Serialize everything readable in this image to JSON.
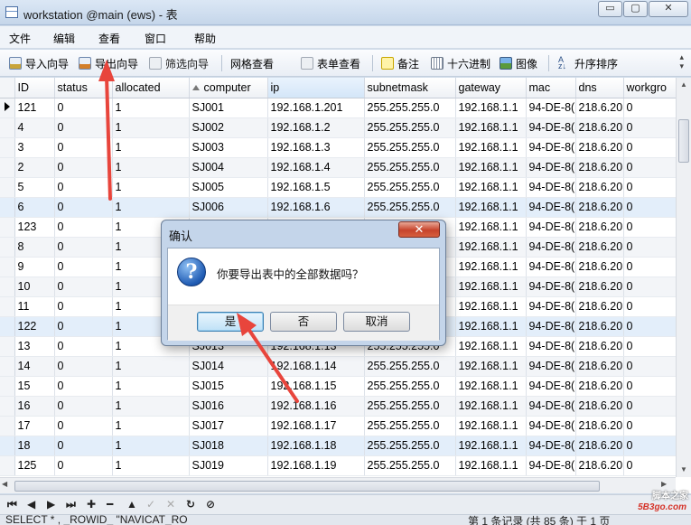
{
  "window": {
    "title": "workstation @main (ews) - 表",
    "buttons": {
      "min": "▭",
      "max": "▢",
      "close": "✕"
    }
  },
  "menu": [
    "文件",
    "编辑",
    "查看",
    "窗口",
    "帮助"
  ],
  "toolbar": {
    "import_wizard": "导入向导",
    "export_wizard": "导出向导",
    "filter_wizard": "筛选向导",
    "grid_view": "网格查看",
    "form_view": "表单查看",
    "memo": "备注",
    "hex": "十六进制",
    "image": "图像",
    "sort_asc": "升序排序",
    "icons": [
      "import-icon",
      "export-icon",
      "filter-icon",
      "grid-icon",
      "form-icon",
      "note-icon",
      "hex-icon",
      "image-icon",
      "sort-icon"
    ]
  },
  "table": {
    "columns": [
      "ID",
      "status",
      "allocated",
      "computer",
      "ip",
      "subnetmask",
      "gateway",
      "mac",
      "dns",
      "workgro"
    ],
    "sorted_column": "computer",
    "rows": [
      [
        "121",
        "0",
        "1",
        "SJ001",
        "192.168.1.201",
        "255.255.255.0",
        "192.168.1.1",
        "94-DE-8(",
        "218.6.20",
        "0"
      ],
      [
        "4",
        "0",
        "1",
        "SJ002",
        "192.168.1.2",
        "255.255.255.0",
        "192.168.1.1",
        "94-DE-8(",
        "218.6.20",
        "0"
      ],
      [
        "3",
        "0",
        "1",
        "SJ003",
        "192.168.1.3",
        "255.255.255.0",
        "192.168.1.1",
        "94-DE-8(",
        "218.6.20",
        "0"
      ],
      [
        "2",
        "0",
        "1",
        "SJ004",
        "192.168.1.4",
        "255.255.255.0",
        "192.168.1.1",
        "94-DE-8(",
        "218.6.20",
        "0"
      ],
      [
        "5",
        "0",
        "1",
        "SJ005",
        "192.168.1.5",
        "255.255.255.0",
        "192.168.1.1",
        "94-DE-8(",
        "218.6.20",
        "0"
      ],
      [
        "6",
        "0",
        "1",
        "SJ006",
        "192.168.1.6",
        "255.255.255.0",
        "192.168.1.1",
        "94-DE-8(",
        "218.6.20",
        "0"
      ],
      [
        "123",
        "0",
        "1",
        "",
        "",
        "",
        "192.168.1.1",
        "94-DE-8(",
        "218.6.20",
        "0"
      ],
      [
        "8",
        "0",
        "1",
        "",
        "",
        "",
        "192.168.1.1",
        "94-DE-8(",
        "218.6.20",
        "0"
      ],
      [
        "9",
        "0",
        "1",
        "",
        "",
        "",
        "192.168.1.1",
        "94-DE-8(",
        "218.6.20",
        "0"
      ],
      [
        "10",
        "0",
        "1",
        "",
        "",
        "",
        "192.168.1.1",
        "94-DE-8(",
        "218.6.20",
        "0"
      ],
      [
        "11",
        "0",
        "1",
        "",
        "",
        "",
        "192.168.1.1",
        "94-DE-8(",
        "218.6.20",
        "0"
      ],
      [
        "122",
        "0",
        "1",
        "",
        "",
        "",
        "192.168.1.1",
        "94-DE-8(",
        "218.6.20",
        "0"
      ],
      [
        "13",
        "0",
        "1",
        "SJ013",
        "192.168.1.13",
        "255.255.255.0",
        "192.168.1.1",
        "94-DE-8(",
        "218.6.20",
        "0"
      ],
      [
        "14",
        "0",
        "1",
        "SJ014",
        "192.168.1.14",
        "255.255.255.0",
        "192.168.1.1",
        "94-DE-8(",
        "218.6.20",
        "0"
      ],
      [
        "15",
        "0",
        "1",
        "SJ015",
        "192.168.1.15",
        "255.255.255.0",
        "192.168.1.1",
        "94-DE-8(",
        "218.6.20",
        "0"
      ],
      [
        "16",
        "0",
        "1",
        "SJ016",
        "192.168.1.16",
        "255.255.255.0",
        "192.168.1.1",
        "94-DE-8(",
        "218.6.20",
        "0"
      ],
      [
        "17",
        "0",
        "1",
        "SJ017",
        "192.168.1.17",
        "255.255.255.0",
        "192.168.1.1",
        "94-DE-8(",
        "218.6.20",
        "0"
      ],
      [
        "18",
        "0",
        "1",
        "SJ018",
        "192.168.1.18",
        "255.255.255.0",
        "192.168.1.1",
        "94-DE-8(",
        "218.6.20",
        "0"
      ],
      [
        "125",
        "0",
        "1",
        "SJ019",
        "192.168.1.19",
        "255.255.255.0",
        "192.168.1.1",
        "94-DE-8(",
        "218.6.20",
        "0"
      ]
    ]
  },
  "navbar": [
    "⏮",
    "◀",
    "▶",
    "⏭",
    "✚",
    "━",
    "▲",
    "✓",
    "✕",
    "↻",
    "⊘"
  ],
  "status": {
    "sql": "SELECT * , _ROWID_ \"NAVICAT_RO",
    "record": "第 1 条记录 (共 85 条) 于 1 页"
  },
  "dialog": {
    "title": "确认",
    "message": "你要导出表中的全部数据吗？",
    "yes": "是",
    "no": "否",
    "cancel": "取消",
    "close": "✕",
    "icon": "question-icon"
  },
  "watermark": {
    "line1": "脚本之家",
    "line2": "5B3go.com"
  },
  "colors": {
    "arrow": "#e8453c",
    "accent": "#3c7fb1"
  }
}
